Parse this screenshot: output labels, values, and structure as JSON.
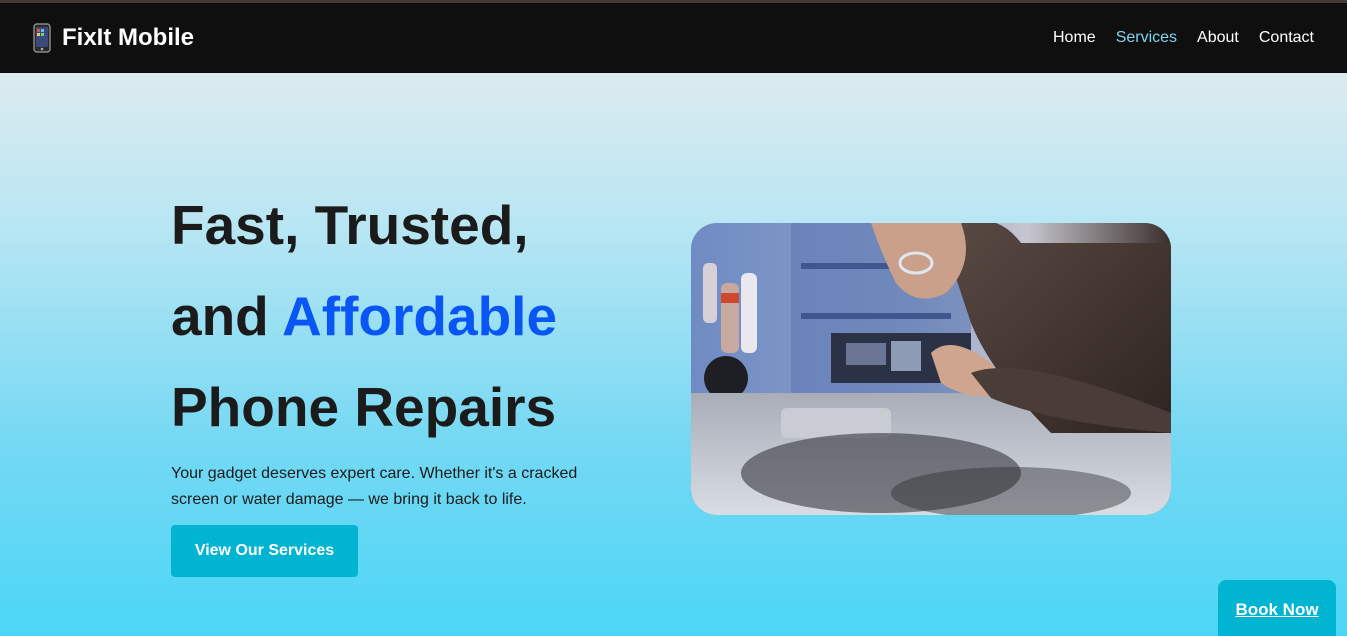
{
  "brand": {
    "icon": "mobile-phone-icon",
    "name": "FixIt Mobile"
  },
  "nav": {
    "items": [
      "Home",
      "Services",
      "About",
      "Contact"
    ],
    "active": "Services"
  },
  "hero": {
    "line1": "Fast, Trusted,",
    "line2_prefix": "and",
    "line2_accent": "Affordable",
    "line3": "Phone Repairs",
    "lede": "Your gadget deserves expert care. Whether it's a cracked screen or water damage — we bring it back to life.",
    "cta": "View Our Services",
    "image": "technician-repairing-phone-photo"
  },
  "floating": {
    "book_now": "Book Now"
  },
  "colors": {
    "accent": "#0a56f5",
    "cta": "#00b4d2",
    "nav_bg": "#0f0f10",
    "nav_active": "#7fd4ea",
    "text": "#1b1b1b"
  }
}
